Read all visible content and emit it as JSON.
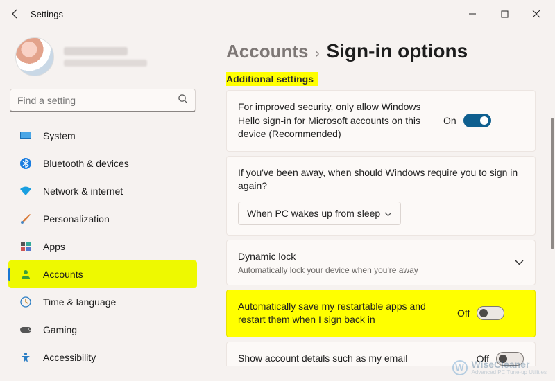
{
  "titlebar": {
    "title": "Settings"
  },
  "search": {
    "placeholder": "Find a setting"
  },
  "nav": {
    "items": [
      {
        "label": "System"
      },
      {
        "label": "Bluetooth & devices"
      },
      {
        "label": "Network & internet"
      },
      {
        "label": "Personalization"
      },
      {
        "label": "Apps"
      },
      {
        "label": "Accounts"
      },
      {
        "label": "Time & language"
      },
      {
        "label": "Gaming"
      },
      {
        "label": "Accessibility"
      }
    ]
  },
  "breadcrumb": {
    "parent": "Accounts",
    "current": "Sign-in options"
  },
  "section": "Additional settings",
  "cards": {
    "hello": {
      "text": "For improved security, only allow Windows Hello sign-in for Microsoft accounts on this device (Recommended)",
      "state": "On"
    },
    "away": {
      "text": "If you've been away, when should Windows require you to sign in again?",
      "select": "When PC wakes up from sleep"
    },
    "dynlock": {
      "title": "Dynamic lock",
      "sub": "Automatically lock your device when you're away"
    },
    "restart": {
      "text": "Automatically save my restartable apps and restart them when I sign back in",
      "state": "Off"
    },
    "email": {
      "text": "Show account details such as my email",
      "state": "Off"
    }
  },
  "watermark": {
    "brand": "WiseCleaner",
    "tag": "Advanced PC Tune-up Utilities"
  }
}
